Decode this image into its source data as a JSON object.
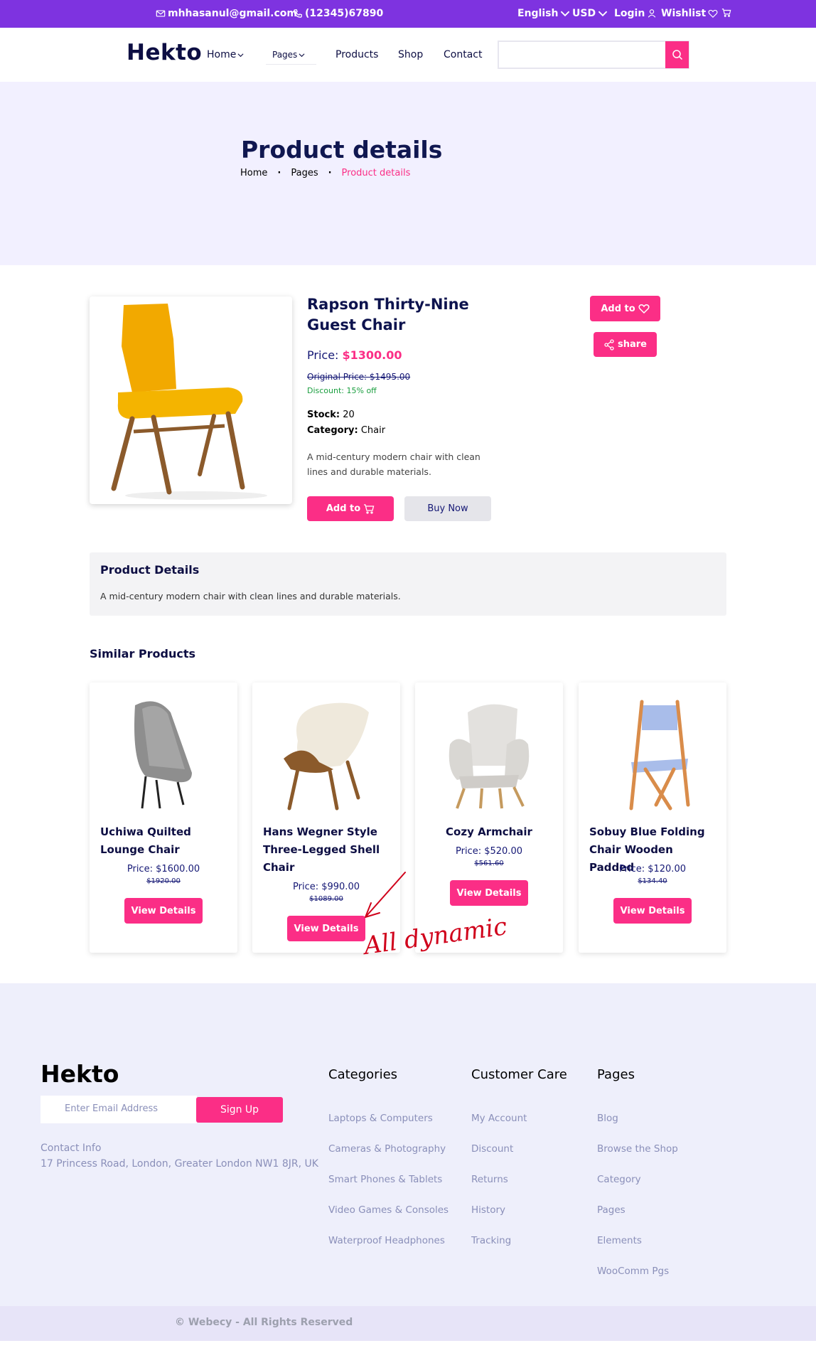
{
  "topbar": {
    "email": "mhhasanul@gmail.com",
    "phone": "(12345)67890",
    "language": "English",
    "currency": "USD",
    "login": "Login",
    "wishlist": "Wishlist"
  },
  "nav": {
    "logo": "Hekto",
    "home": "Home",
    "pages": "Pages",
    "products": "Products",
    "shop": "Shop",
    "contact": "Contact",
    "search_value": ""
  },
  "hero": {
    "title": "Product details",
    "crumbs": [
      "Home",
      "Pages",
      "Product details"
    ]
  },
  "product": {
    "name": "Rapson Thirty-Nine Guest Chair",
    "price_label": "Price:",
    "price": "$1300.00",
    "original": "Original Price: $1495.00",
    "discount": "Discount: 15% off",
    "stock_label": "Stock:",
    "stock": "20",
    "category_label": "Category:",
    "category": "Chair",
    "description": "A mid-century modern chair with clean lines and durable materials.",
    "add_to": "Add to",
    "buy_now": "Buy Now",
    "wishlist_label": "Add to",
    "share": "share",
    "image_color": "#F4B400"
  },
  "details": {
    "title": "Product Details",
    "text": "A mid-century modern chair with clean lines and durable materials."
  },
  "similar": {
    "title": "Similar Products",
    "button_label": "View Details",
    "items": [
      {
        "name": "Uchiwa Quilted Lounge Chair",
        "price": "Price: $1600.00",
        "old": "$1920.00"
      },
      {
        "name": "Hans Wegner Style Three-Legged Shell Chair",
        "price": "Price: $990.00",
        "old": "$1089.00"
      },
      {
        "name": "Cozy Armchair",
        "price": "Price: $520.00",
        "old": "$561.60"
      },
      {
        "name": "Sobuy Blue Folding Chair Wooden Padded",
        "price": "Price: $120.00",
        "old": "$134.40"
      }
    ]
  },
  "annotation": "All dynamic",
  "footer": {
    "logo": "Hekto",
    "email_placeholder": "Enter Email Address",
    "signup": "Sign Up",
    "contact_label": "Contact Info",
    "address": "17 Princess Road, London, Greater London NW1 8JR, UK",
    "categories": {
      "title": "Categories",
      "items": [
        "Laptops & Computers",
        "Cameras & Photography",
        "Smart Phones & Tablets",
        "Video Games & Consoles",
        "Waterproof Headphones"
      ]
    },
    "care": {
      "title": "Customer Care",
      "items": [
        "My Account",
        "Discount",
        "Returns",
        "History",
        "Tracking"
      ]
    },
    "pages": {
      "title": "Pages",
      "items": [
        "Blog",
        "Browse the Shop",
        "Category",
        "Pages",
        "Elements",
        "WooComm Pgs"
      ]
    },
    "copyright": "© Webecy - All Rights Reserved"
  },
  "colors": {
    "topbar": "#7E33E0",
    "accent": "#FB2E86",
    "navy": "#151875",
    "hero_bg": "#F2F0FF",
    "footer_bg": "#EEEFFB"
  }
}
